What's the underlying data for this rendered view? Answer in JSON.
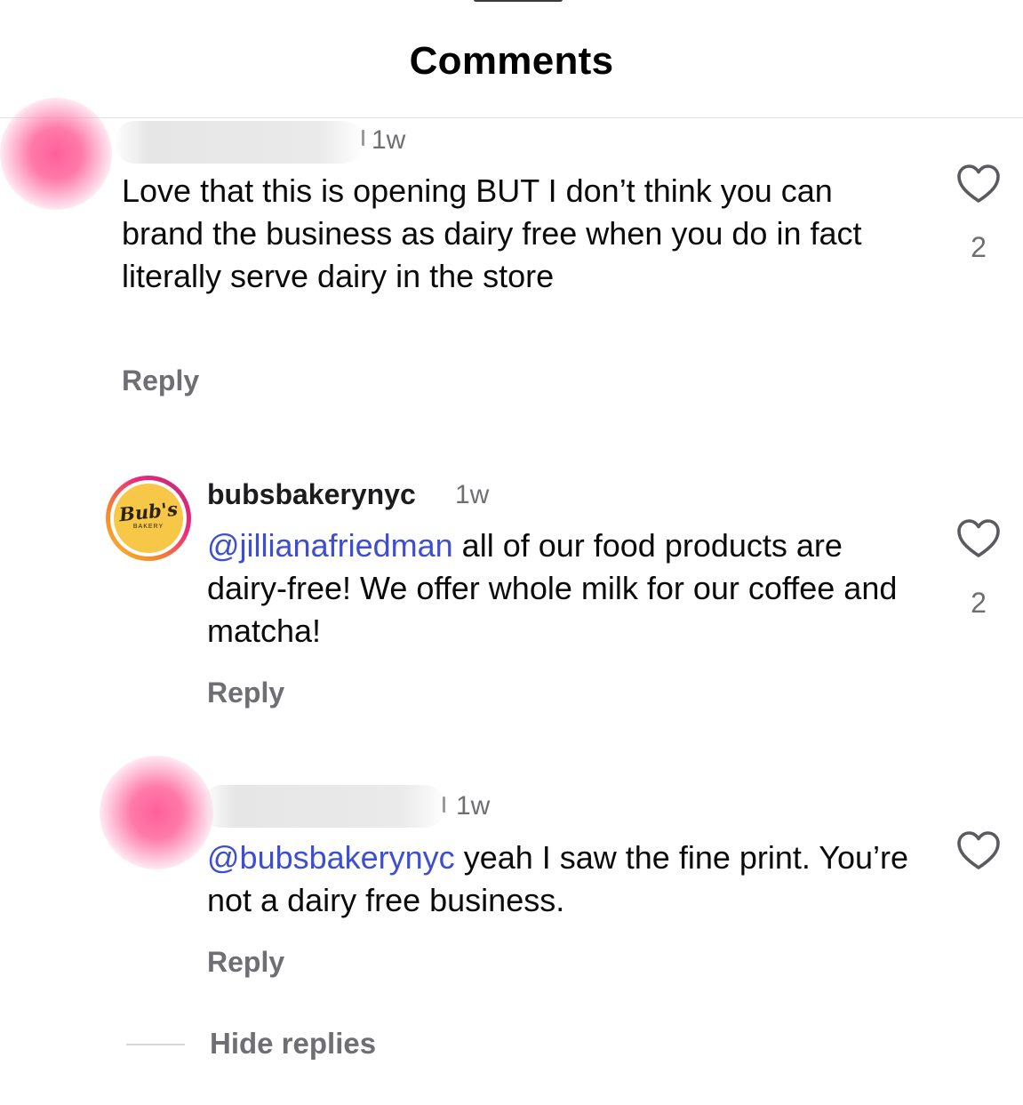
{
  "sheet": {
    "title": "Comments"
  },
  "comments": [
    {
      "time": "1w",
      "text": "Love that this is opening BUT I don’t think you can brand the business as dairy free when you do in fact literally serve dairy in the store",
      "reply_label": "Reply",
      "like_count": "2",
      "icon": "heart-icon"
    },
    {
      "username": "bubsbakerynyc",
      "time": "1w",
      "mention": "@jillianafriedman",
      "text": " all of our food products are dairy-free! We offer whole milk for our coffee and matcha!",
      "reply_label": "Reply",
      "like_count": "2",
      "avatar_logo_text": "Bub's",
      "avatar_logo_subtext": "BAKERY",
      "icon": "heart-icon"
    },
    {
      "time": "1w",
      "mention": "@bubsbakerynyc",
      "text": " yeah I saw the fine print. You’re not a dairy free business.",
      "reply_label": "Reply",
      "icon": "heart-icon"
    }
  ],
  "thread": {
    "hide_replies_label": "Hide replies"
  },
  "colors": {
    "mention": "#3d4ed1",
    "secondary_text": "#6e6e73",
    "logo_background": "#f7c848"
  }
}
